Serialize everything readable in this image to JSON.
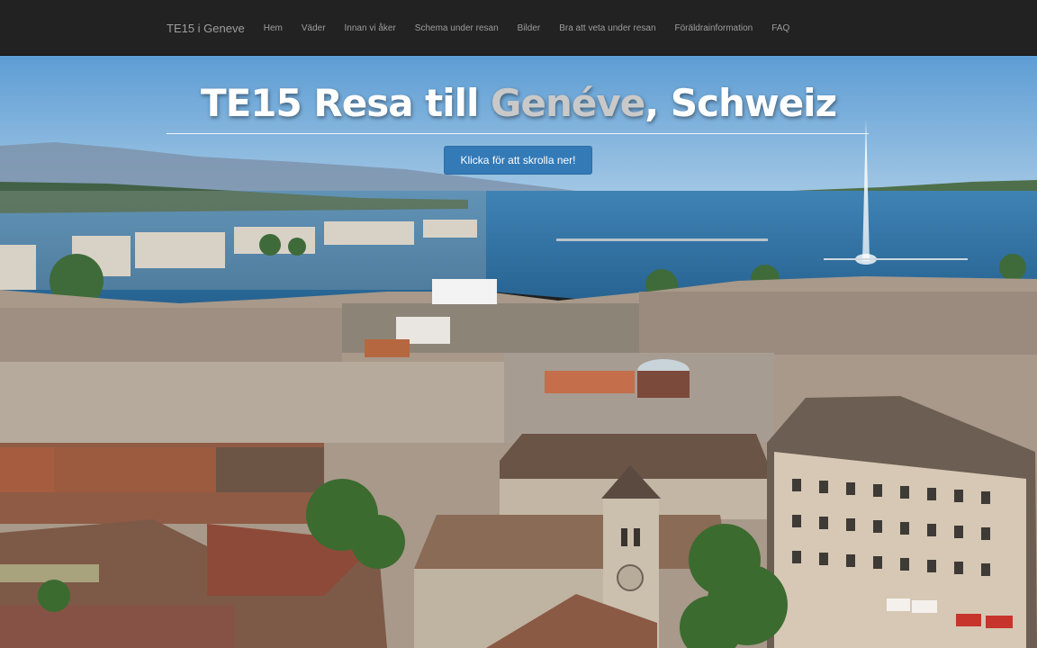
{
  "navbar": {
    "brand": "TE15 i Geneve",
    "links": [
      {
        "label": "Hem"
      },
      {
        "label": "Väder"
      },
      {
        "label": "Innan vi åker"
      },
      {
        "label": "Schema under resan"
      },
      {
        "label": "Bilder"
      },
      {
        "label": "Bra att veta under resan"
      },
      {
        "label": "Föräldrainformation"
      },
      {
        "label": "FAQ"
      }
    ]
  },
  "hero": {
    "title_prefix": "TE15 Resa till ",
    "title_highlight": "Genéve",
    "title_suffix": ", Schweiz",
    "button_label": "Klicka för att skrolla ner!"
  },
  "colors": {
    "navbar_bg": "#222222",
    "nav_text": "#9d9d9d",
    "button_bg": "#337ab7",
    "sky": "#6fa9d8",
    "lake": "#2f6f9f"
  }
}
